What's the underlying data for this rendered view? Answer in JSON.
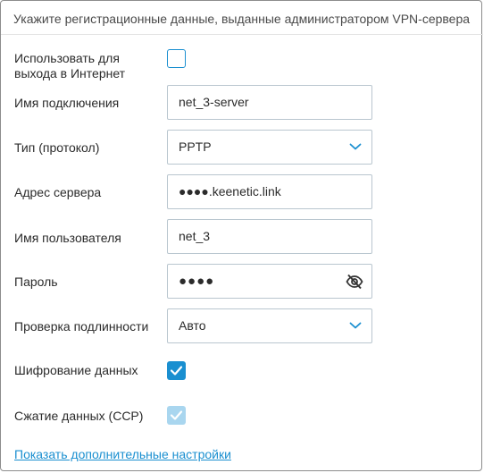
{
  "header": {
    "text": "Укажите регистрационные данные, выданные администратором VPN-сервера"
  },
  "fields": {
    "use_for_internet": {
      "label": "Использовать для выхода в Интернет",
      "checked": false
    },
    "connection_name": {
      "label": "Имя подключения",
      "value": "net_3-server"
    },
    "protocol_type": {
      "label": "Тип (протокол)",
      "value": "PPTP"
    },
    "server_address": {
      "label": "Адрес сервера",
      "value": "●●●●.keenetic.link"
    },
    "username": {
      "label": "Имя пользователя",
      "value": "net_3"
    },
    "password": {
      "label": "Пароль",
      "value": "●●●●"
    },
    "authentication": {
      "label": "Проверка подлинности",
      "value": "Авто"
    },
    "data_encryption": {
      "label": "Шифрование данных",
      "checked": true
    },
    "data_compression": {
      "label": "Сжатие данных (CCP)",
      "checked": true,
      "disabled": true
    }
  },
  "advanced_link": "Показать дополнительные настройки",
  "colors": {
    "accent": "#1a8fd0",
    "accent_disabled": "#a9d6ef",
    "input_border": "#b9c6cf"
  },
  "icons": {
    "select": "chevron-down-icon",
    "password_toggle": "eye-off-icon",
    "check": "checkmark-icon"
  }
}
